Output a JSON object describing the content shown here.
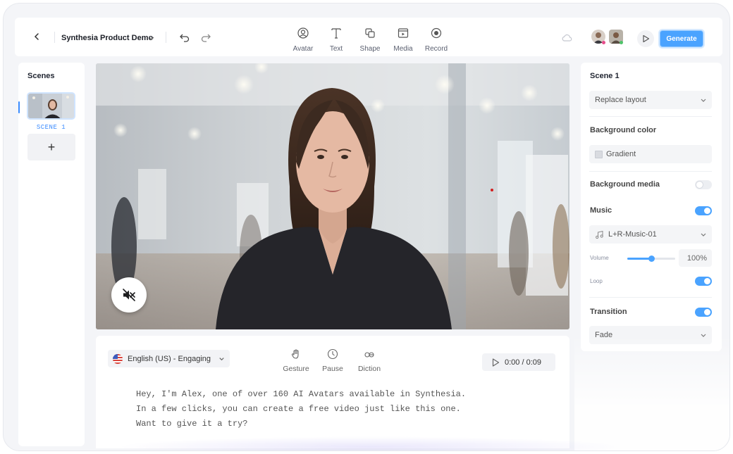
{
  "topbar": {
    "project_title": "Synthesia Product Demo",
    "tools": [
      {
        "label": "Avatar",
        "icon": "avatar-icon"
      },
      {
        "label": "Text",
        "icon": "text-icon"
      },
      {
        "label": "Shape",
        "icon": "shape-icon"
      },
      {
        "label": "Media",
        "icon": "media-icon"
      },
      {
        "label": "Record",
        "icon": "record-icon"
      }
    ],
    "generate_label": "Generate"
  },
  "scenes": {
    "title": "Scenes",
    "items": [
      {
        "label": "SCENE 1"
      }
    ],
    "add_label": "+"
  },
  "script": {
    "voice": "English (US) - Engaging",
    "tools": [
      {
        "label": "Gesture",
        "icon": "hand-icon"
      },
      {
        "label": "Pause",
        "icon": "clock-icon"
      },
      {
        "label": "Diction",
        "icon": "diction-icon"
      }
    ],
    "time": "0:00 / 0:09",
    "lines": [
      "Hey, I'm Alex, one of over 160 AI Avatars available in Synthesia.",
      "In a few clicks, you can create a free video just like this one.",
      "Want to give it a try?"
    ]
  },
  "properties": {
    "title": "Scene 1",
    "layout_select": "Replace layout",
    "background_color_label": "Background color",
    "background_color_value": "Gradient",
    "background_media_label": "Background media",
    "background_media_enabled": false,
    "music_label": "Music",
    "music_enabled": true,
    "music_track": "L+R-Music-01",
    "volume_label": "Volume",
    "volume_value": "100%",
    "volume_level": 0.5,
    "loop_label": "Loop",
    "loop_enabled": true,
    "transition_label": "Transition",
    "transition_enabled": true,
    "transition_value": "Fade"
  },
  "colors": {
    "accent": "#4aa3ff",
    "scene_label": "#3b8cff"
  }
}
